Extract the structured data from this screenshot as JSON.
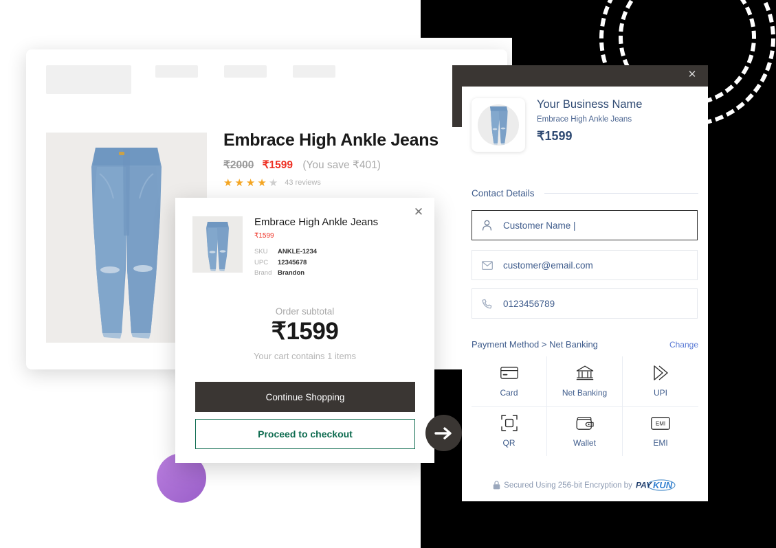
{
  "storefront": {
    "nav": {
      "logo_placeholder": "",
      "items": [
        "",
        "",
        ""
      ]
    },
    "product": {
      "title": "Embrace High Ankle Jeans",
      "price_old": "₹2000",
      "price_new": "₹1599",
      "price_save": "(You save ₹401)",
      "rating_filled": 4,
      "rating_total": 5,
      "review_count": "43 reviews",
      "image_alt": "blue-jeans"
    }
  },
  "cart_modal": {
    "close_glyph": "✕",
    "item": {
      "name": "Embrace High Ankle Jeans",
      "price": "₹1599",
      "meta": [
        {
          "label": "SKU",
          "value": "ANKLE-1234"
        },
        {
          "label": "UPC",
          "value": "12345678"
        },
        {
          "label": "Brand",
          "value": "Brandon"
        }
      ]
    },
    "subtotal_label": "Order subtotal",
    "subtotal_amount": "₹1599",
    "cart_count_text": "Your cart contains 1 items",
    "continue_label": "Continue Shopping",
    "checkout_label": "Proceed to checkout"
  },
  "arrow": {
    "icon": "arrow-right-icon"
  },
  "checkout": {
    "close_glyph": "✕",
    "business_name": "Your Business Name",
    "product_name": "Embrace High Ankle Jeans",
    "amount": "₹1599",
    "contact_title": "Contact Details",
    "fields": [
      {
        "icon": "user-icon",
        "value": "Customer Name |",
        "placeholder": "Customer Name"
      },
      {
        "icon": "mail-icon",
        "value": "customer@email.com",
        "placeholder": "Email"
      },
      {
        "icon": "phone-icon",
        "value": "0123456789",
        "placeholder": "Phone"
      }
    ],
    "payment_method_label": "Payment Method > Net Banking",
    "change_label": "Change",
    "payment_methods": [
      {
        "icon": "card-icon",
        "name": "Card"
      },
      {
        "icon": "bank-icon",
        "name": "Net Banking"
      },
      {
        "icon": "upi-icon",
        "name": "UPI"
      },
      {
        "icon": "qr-icon",
        "name": "QR"
      },
      {
        "icon": "wallet-icon",
        "name": "Wallet"
      },
      {
        "icon": "emi-icon",
        "name": "EMI"
      }
    ],
    "emi_icon_text": "EMI",
    "secure_text": "Secured Using 256-bit Encryption by",
    "brand_pay": "PAY",
    "brand_kun": "KUN"
  },
  "colors": {
    "accent_red": "#ee3124",
    "accent_green": "#0d6b4f",
    "dark": "#3a3633",
    "navy": "#2f4a73",
    "link_blue": "#5b7bd5",
    "purple": "#9a5fc9",
    "green_circle": "#5da363"
  }
}
